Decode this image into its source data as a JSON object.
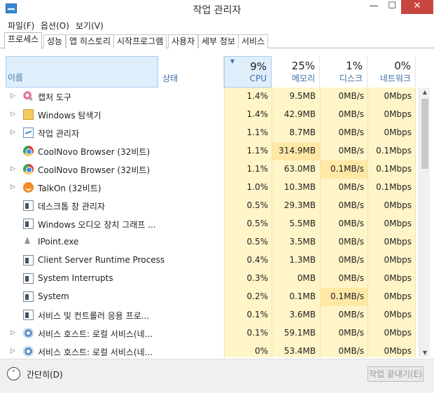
{
  "window": {
    "title": "작업 관리자",
    "min_glyph": "—",
    "max_glyph": "☐",
    "close_glyph": "✕"
  },
  "menu": [
    "파일(F)",
    "옵션(O)",
    "보기(V)"
  ],
  "tabs": [
    "프로세스",
    "성능",
    "앱 히스토리",
    "시작프로그램",
    "사용자",
    "세부 정보",
    "서비스"
  ],
  "active_tab": "프로세스",
  "header": {
    "name": "이름",
    "status": "상태",
    "cpu": {
      "pct": "9%",
      "label": "CPU"
    },
    "memory": {
      "pct": "25%",
      "label": "메모리"
    },
    "disk": {
      "pct": "1%",
      "label": "디스크"
    },
    "network": {
      "pct": "0%",
      "label": "네트워크"
    }
  },
  "processes": [
    {
      "name": "캡처 도구",
      "icon": "scissors-icon",
      "expandable": true,
      "cpu": "1.4%",
      "memory": "9.5MB",
      "disk": "0MB/s",
      "network": "0Mbps"
    },
    {
      "name": "Windows 탐색기",
      "icon": "folder-icon",
      "expandable": true,
      "cpu": "1.4%",
      "memory": "42.9MB",
      "disk": "0MB/s",
      "network": "0Mbps"
    },
    {
      "name": "작업 관리자",
      "icon": "task-manager-icon",
      "expandable": true,
      "cpu": "1.1%",
      "memory": "8.7MB",
      "disk": "0MB/s",
      "network": "0Mbps"
    },
    {
      "name": "CoolNovo Browser (32비트)",
      "icon": "coolnovo-icon",
      "expandable": false,
      "cpu": "1.1%",
      "memory": "314.9MB",
      "disk": "0MB/s",
      "network": "0.1Mbps"
    },
    {
      "name": "CoolNovo Browser (32비트)",
      "icon": "coolnovo-icon",
      "expandable": true,
      "cpu": "1.1%",
      "memory": "63.0MB",
      "disk": "0.1MB/s",
      "network": "0.1Mbps"
    },
    {
      "name": "TalkOn (32비트)",
      "icon": "talkon-icon",
      "expandable": true,
      "cpu": "1.0%",
      "memory": "10.3MB",
      "disk": "0MB/s",
      "network": "0.1Mbps"
    },
    {
      "name": "데스크톱 창 관리자",
      "icon": "window-icon",
      "expandable": false,
      "cpu": "0.5%",
      "memory": "29.3MB",
      "disk": "0MB/s",
      "network": "0Mbps"
    },
    {
      "name": "Windows 오디오 장치 그래프 ...",
      "icon": "window-icon",
      "expandable": false,
      "cpu": "0.5%",
      "memory": "5.5MB",
      "disk": "0MB/s",
      "network": "0Mbps"
    },
    {
      "name": "IPoint.exe",
      "icon": "pointer-icon",
      "expandable": false,
      "cpu": "0.5%",
      "memory": "3.5MB",
      "disk": "0MB/s",
      "network": "0Mbps"
    },
    {
      "name": "Client Server Runtime Process",
      "icon": "window-icon",
      "expandable": false,
      "cpu": "0.4%",
      "memory": "1.3MB",
      "disk": "0MB/s",
      "network": "0Mbps"
    },
    {
      "name": "System Interrupts",
      "icon": "window-icon",
      "expandable": false,
      "cpu": "0.3%",
      "memory": "0MB",
      "disk": "0MB/s",
      "network": "0Mbps"
    },
    {
      "name": "System",
      "icon": "window-icon",
      "expandable": false,
      "cpu": "0.2%",
      "memory": "0.1MB",
      "disk": "0.1MB/s",
      "network": "0Mbps"
    },
    {
      "name": "서비스 및 컨트롤러 응용 프로...",
      "icon": "window-icon",
      "expandable": false,
      "cpu": "0.1%",
      "memory": "3.6MB",
      "disk": "0MB/s",
      "network": "0Mbps"
    },
    {
      "name": "서비스 호스트: 로컬 서비스(네...",
      "icon": "gear-icon",
      "expandable": true,
      "cpu": "0.1%",
      "memory": "59.1MB",
      "disk": "0MB/s",
      "network": "0Mbps"
    },
    {
      "name": "서비스 호스트: 로컬 서비스(네...",
      "icon": "gear-icon",
      "expandable": true,
      "cpu": "0%",
      "memory": "53.4MB",
      "disk": "0MB/s",
      "network": "0Mbps"
    }
  ],
  "footer": {
    "fewer_details": "간단히(D)",
    "end_task": "작업 끝내기(E)"
  },
  "colors": {
    "cell_background": "#fff5c8",
    "cell_highlight": "#ffe8a6",
    "header_selected": "#deeefb",
    "header_text": "#3d6fa6",
    "close_button": "#c7463f"
  }
}
